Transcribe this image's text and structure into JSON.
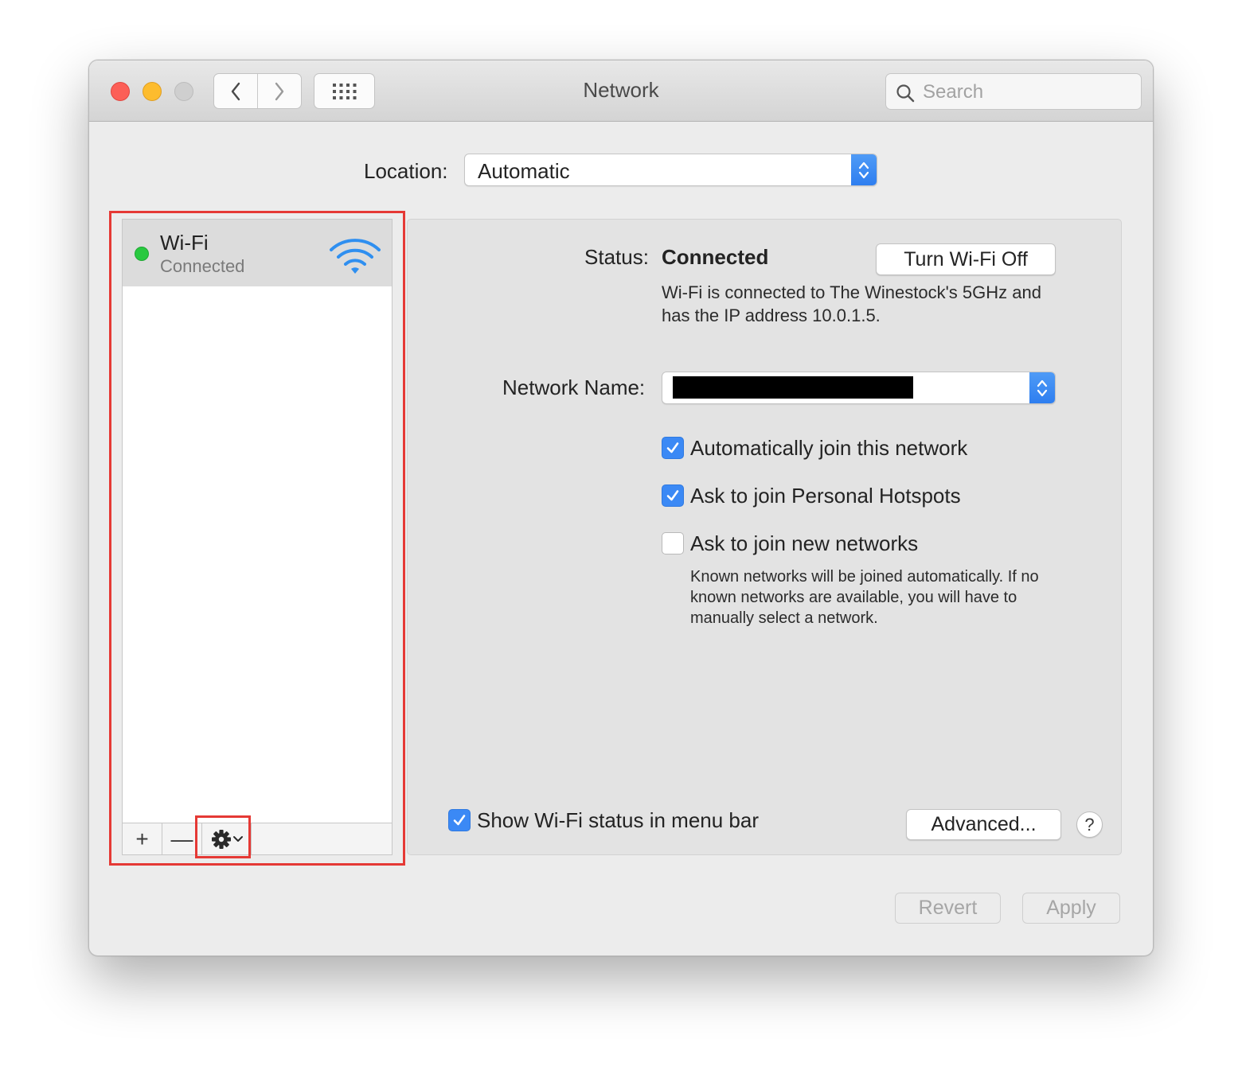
{
  "window": {
    "title": "Network"
  },
  "search": {
    "placeholder": "Search"
  },
  "location": {
    "label": "Location:",
    "value": "Automatic"
  },
  "services": [
    {
      "name": "Wi-Fi",
      "status": "Connected",
      "status_color": "#29c940",
      "icon": "wifi-icon"
    }
  ],
  "sidebar_toolbar": {
    "add": "+",
    "remove": "—",
    "action_icon": "gear-icon"
  },
  "detail": {
    "status_label": "Status:",
    "status_value": "Connected",
    "toggle_button": "Turn Wi-Fi Off",
    "description": "Wi-Fi is connected to The Winestock's 5GHz and has the IP address 10.0.1.5.",
    "network_name_label": "Network Name:",
    "options": [
      {
        "label": "Automatically join this network",
        "checked": true
      },
      {
        "label": "Ask to join Personal Hotspots",
        "checked": true
      },
      {
        "label": "Ask to join new networks",
        "checked": false
      }
    ],
    "hint": "Known networks will be joined automatically. If no known networks are available, you will have to manually select a network.",
    "show_status": {
      "label": "Show Wi-Fi status in menu bar",
      "checked": true
    },
    "advanced_button": "Advanced...",
    "help": "?"
  },
  "footer": {
    "revert": "Revert",
    "apply": "Apply"
  },
  "colors": {
    "accent": "#3b89f5",
    "highlight": "#e53935"
  }
}
